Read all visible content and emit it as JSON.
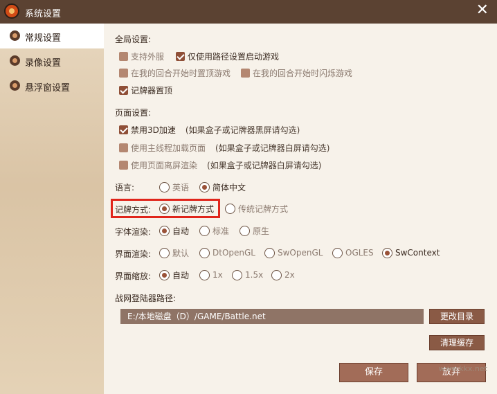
{
  "window": {
    "title": "系统设置"
  },
  "sidebar": {
    "items": [
      {
        "label": "常规设置",
        "active": true
      },
      {
        "label": "录像设置",
        "active": false
      },
      {
        "label": "悬浮窗设置",
        "active": false
      }
    ]
  },
  "global": {
    "title": "全局设置:",
    "options": [
      {
        "label": "支持外服",
        "checked": false,
        "enabled": false
      },
      {
        "label": "仅使用路径设置启动游戏",
        "checked": true,
        "enabled": true
      },
      {
        "label": "在我的回合开始时置顶游戏",
        "checked": false,
        "enabled": false
      },
      {
        "label": "在我的回合开始时闪烁游戏",
        "checked": false,
        "enabled": false
      },
      {
        "label": "记牌器置顶",
        "checked": true,
        "enabled": true
      }
    ]
  },
  "page": {
    "title": "页面设置:",
    "options": [
      {
        "label": "禁用3D加速",
        "hint": "(如果盒子或记牌器黑屏请勾选)",
        "checked": true,
        "enabled": true
      },
      {
        "label": "使用主线程加载页面",
        "hint": "(如果盒子或记牌器白屏请勾选)",
        "checked": false,
        "enabled": false
      },
      {
        "label": "使用页面离屏渲染",
        "hint": "(如果盒子或记牌器白屏请勾选)",
        "checked": false,
        "enabled": false
      }
    ]
  },
  "language": {
    "label": "语言:",
    "options": [
      "英语",
      "简体中文"
    ],
    "selected": "简体中文"
  },
  "record_mode": {
    "label": "记牌方式:",
    "options": [
      "新记牌方式",
      "传统记牌方式"
    ],
    "selected": "新记牌方式"
  },
  "font_render": {
    "label": "字体渲染:",
    "options": [
      "自动",
      "标准",
      "原生"
    ],
    "selected": "自动"
  },
  "ui_render": {
    "label": "界面渲染:",
    "options": [
      "默认",
      "DtOpenGL",
      "SwOpenGL",
      "OGLES",
      "SwContext"
    ],
    "selected": "SwContext"
  },
  "ui_scale": {
    "label": "界面缩放:",
    "options": [
      "自动",
      "1x",
      "1.5x",
      "2x"
    ],
    "selected": "自动"
  },
  "launcher": {
    "label": "战网登陆器路径:",
    "path": "E:/本地磁盘（D）/GAME/Battle.net",
    "change_dir": "更改目录",
    "clear_cache": "清理缓存"
  },
  "footer": {
    "save": "保存",
    "cancel": "放弃"
  },
  "watermark": "www.kkx.net"
}
